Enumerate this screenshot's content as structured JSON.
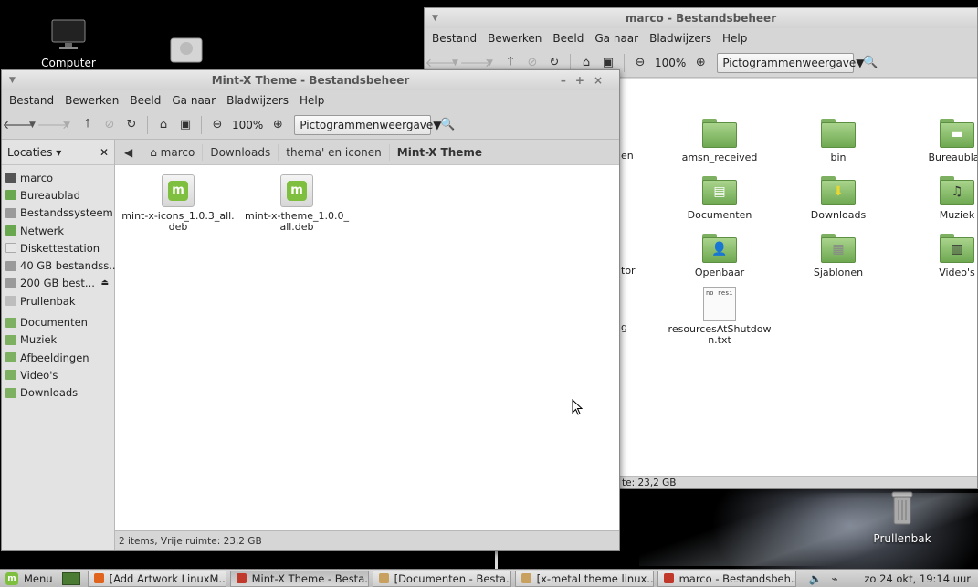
{
  "desktop": {
    "icons": [
      {
        "label": "Computer"
      },
      {
        "label": ""
      },
      {
        "label": "Prullenbak"
      }
    ]
  },
  "back_window": {
    "title": "marco - Bestandsbeheer",
    "menu": [
      "Bestand",
      "Bewerken",
      "Beeld",
      "Ga naar",
      "Bladwijzers",
      "Help"
    ],
    "zoom": "100%",
    "view_mode": "Pictogrammenweergave",
    "partial_labels": [
      "en",
      "tor",
      "g"
    ],
    "folders": [
      {
        "label": "amsn_received",
        "emblem": ""
      },
      {
        "label": "bin",
        "emblem": ""
      },
      {
        "label": "Bureaublad",
        "emblem": "▬"
      },
      {
        "label": "Documenten",
        "emblem": "▤"
      },
      {
        "label": "Downloads",
        "emblem": "⬇"
      },
      {
        "label": "Muziek",
        "emblem": "♫"
      },
      {
        "label": "Openbaar",
        "emblem": "👤"
      },
      {
        "label": "Sjablonen",
        "emblem": "▦"
      },
      {
        "label": "Video's",
        "emblem": "▥"
      }
    ],
    "textfile": {
      "label": "resourcesAtShutdown.txt",
      "preview": "no resi"
    },
    "status": "te: 23,2 GB"
  },
  "front_window": {
    "title": "Mint-X Theme - Bestandsbeheer",
    "menu": [
      "Bestand",
      "Bewerken",
      "Beeld",
      "Ga naar",
      "Bladwijzers",
      "Help"
    ],
    "zoom": "100%",
    "view_mode": "Pictogrammenweergave",
    "sidebar_header": "Locaties",
    "places": [
      {
        "label": "marco",
        "icon": "home-icon",
        "color": "#555555"
      },
      {
        "label": "Bureaublad",
        "icon": "desktop-icon",
        "color": "#6aa84f"
      },
      {
        "label": "Bestandssysteem",
        "icon": "drive-icon",
        "color": "#9a9a9a"
      },
      {
        "label": "Netwerk",
        "icon": "network-icon",
        "color": "#6aa84f"
      },
      {
        "label": "Diskettestation",
        "icon": "floppy-icon",
        "color": "#e6e6e6"
      },
      {
        "label": "40 GB bestandss...",
        "icon": "drive-icon",
        "color": "#9a9a9a"
      },
      {
        "label": "200 GB best...",
        "icon": "drive-icon",
        "color": "#9a9a9a",
        "eject": "⏏"
      },
      {
        "label": "Prullenbak",
        "icon": "trash-icon",
        "color": "#bdbdbd"
      }
    ],
    "bookmarks": [
      {
        "label": "Documenten",
        "icon": "folder-icon",
        "color": "#7eb062"
      },
      {
        "label": "Muziek",
        "icon": "folder-icon",
        "color": "#7eb062"
      },
      {
        "label": "Afbeeldingen",
        "icon": "folder-icon",
        "color": "#7eb062"
      },
      {
        "label": "Video's",
        "icon": "folder-icon",
        "color": "#7eb062"
      },
      {
        "label": "Downloads",
        "icon": "folder-icon",
        "color": "#7eb062"
      }
    ],
    "breadcrumbs": [
      "marco",
      "Downloads",
      "thema' en iconen",
      "Mint-X Theme"
    ],
    "files": [
      {
        "line1": "mint-x-icons_1.0.3_all.",
        "line2": "deb"
      },
      {
        "line1": "mint-x-theme_1.0.0_",
        "line2": "all.deb"
      }
    ],
    "status": "2 items, Vrije ruimte: 23,2 GB"
  },
  "taskbar": {
    "menu_label": "Menu",
    "tasks": [
      {
        "label": "[Add  Artwork LinuxM...",
        "color": "#e0641e"
      },
      {
        "label": "Mint-X Theme - Besta...",
        "color": "#c0392b",
        "active": true
      },
      {
        "label": "[Documenten - Besta...",
        "color": "#c8a060"
      },
      {
        "label": "[x-metal theme linux...",
        "color": "#c8a060"
      },
      {
        "label": "marco - Bestandsbeh...",
        "color": "#c0392b"
      }
    ],
    "clock": "zo 24 okt, 19:14 uur"
  }
}
